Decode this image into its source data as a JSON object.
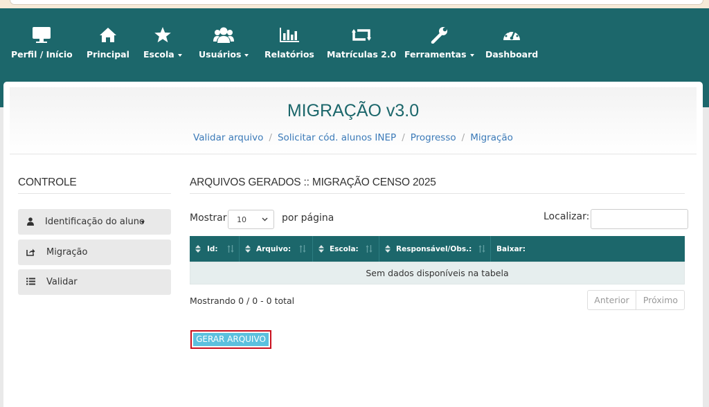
{
  "nav": {
    "items": [
      {
        "label": "Perfil / Início",
        "icon": "monitor-icon"
      },
      {
        "label": "Principal",
        "icon": "home-icon"
      },
      {
        "label": "Escola",
        "icon": "star-icon",
        "dropdown": true
      },
      {
        "label": "Usuários",
        "icon": "users-icon",
        "dropdown": true
      },
      {
        "label": "Relatórios",
        "icon": "bar-chart-icon"
      },
      {
        "label": "Matrículas 2.0",
        "icon": "retweet-icon"
      },
      {
        "label": "Ferramentas",
        "icon": "wrench-icon",
        "dropdown": true
      },
      {
        "label": "Dashboard",
        "icon": "dashboard-icon"
      }
    ]
  },
  "header": {
    "title": "MIGRAÇÃO v3.0",
    "breadcrumb": [
      "Validar arquivo",
      "Solicitar cód. alunos INEP",
      "Progresso",
      "Migração"
    ]
  },
  "sidebar": {
    "title": "CONTROLE",
    "items": [
      {
        "label": "Identificação do aluno",
        "icon": "user-icon",
        "dropdown": true
      },
      {
        "label": "Migração",
        "icon": "share-icon"
      },
      {
        "label": "Validar",
        "icon": "list-icon"
      }
    ]
  },
  "main": {
    "title": "ARQUIVOS GERADOS :: MIGRAÇÃO CENSO 2025",
    "show_label": "Mostrar",
    "page_size": "10",
    "per_page_label": "por página",
    "search_label": "Localizar:",
    "search_value": "",
    "columns": [
      "Id:",
      "Arquivo:",
      "Escola:",
      "Responsável/Obs.:",
      "Baixar:"
    ],
    "empty_message": "Sem dados disponíveis na tabela",
    "info": "Mostrando 0 / 0 - 0 total",
    "prev_label": "Anterior",
    "next_label": "Próximo",
    "generate_button": "GERAR ARQUIVO"
  },
  "colors": {
    "brand": "#1c676b",
    "link": "#3b7ab8",
    "button": "#5bc0de",
    "highlight": "#c9101e"
  }
}
